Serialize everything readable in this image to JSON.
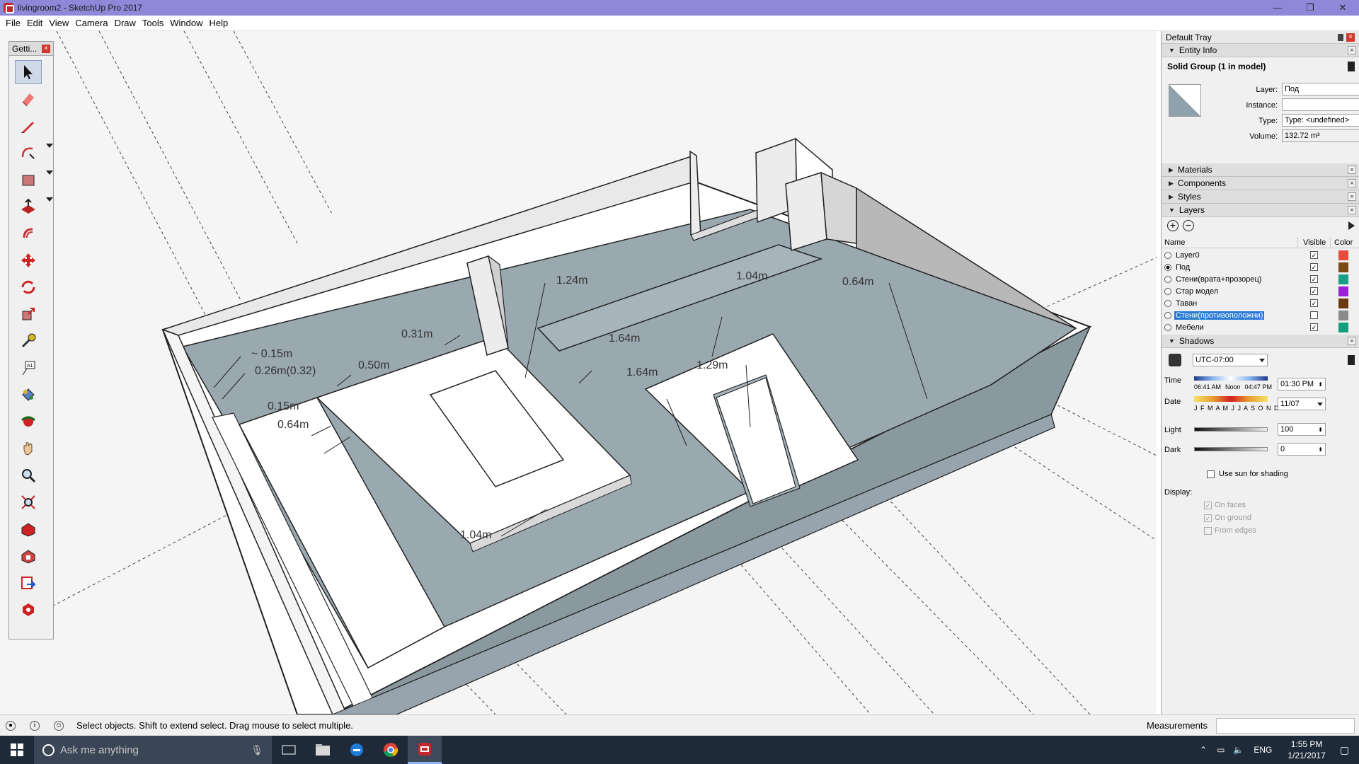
{
  "window": {
    "title": "livingroom2 - SketchUp Pro 2017",
    "controls": [
      "—",
      "❐",
      "✕"
    ]
  },
  "menu": [
    "File",
    "Edit",
    "View",
    "Camera",
    "Draw",
    "Tools",
    "Window",
    "Help"
  ],
  "toolbar": {
    "title": "Getti...",
    "tools": [
      "select-tool",
      "eraser-tool",
      "line-tool",
      "arc-tool",
      "shape-tool",
      "push-pull-tool",
      "offset-tool",
      "move-tool",
      "rotate-tool",
      "scale-tool",
      "tape-measure-tool",
      "text-tool",
      "paint-bucket-tool",
      "orbit-tool",
      "pan-tool",
      "zoom-tool",
      "zoom-extents-tool",
      "3d-warehouse-tool",
      "extension-warehouse-tool",
      "send-to-layout-tool",
      "extension-manager-tool"
    ]
  },
  "dimensions": [
    "1.24m",
    "1.04m",
    "0.64m",
    "0.31m",
    "~ 0.15m",
    "0.26m(0.32)",
    "0.50m",
    "1.64m",
    "1.64m",
    "1.29m",
    "0.15m",
    "0.64m",
    "1.04m"
  ],
  "tray": {
    "title": "Default Tray",
    "entity_info": {
      "header": "Entity Info",
      "selection": "Solid Group (1 in model)",
      "layer_label": "Layer:",
      "layer_value": "Под",
      "instance_label": "Instance:",
      "instance_value": "",
      "type_label": "Type:",
      "type_value": "Type: <undefined>",
      "volume_label": "Volume:",
      "volume_value": "132.72 m³"
    },
    "collapsed_panels": [
      "Materials",
      "Components",
      "Styles"
    ],
    "layers": {
      "header": "Layers",
      "columns": [
        "Name",
        "Visible",
        "Color"
      ],
      "rows": [
        {
          "name": "Layer0",
          "active": false,
          "visible": true,
          "color": "#e84b3c"
        },
        {
          "name": "Под",
          "active": true,
          "visible": true,
          "color": "#7a4a12"
        },
        {
          "name": "Стени(врата+прозорец)",
          "active": false,
          "visible": true,
          "color": "#16a085"
        },
        {
          "name": "Стар модел",
          "active": false,
          "visible": true,
          "color": "#9b21d6"
        },
        {
          "name": "Таван",
          "active": false,
          "visible": true,
          "color": "#6b3a10"
        },
        {
          "name": "Стени(противоположни)",
          "active": false,
          "visible": false,
          "color": "#8a8a8a",
          "selected": true
        },
        {
          "name": "Мебели",
          "active": false,
          "visible": true,
          "color": "#12a07a"
        }
      ]
    },
    "shadows": {
      "header": "Shadows",
      "timezone": "UTC-07:00",
      "time_label": "Time",
      "time_ticks": [
        "06:41 AM",
        "Noon",
        "04:47 PM"
      ],
      "time_value": "01:30 PM",
      "date_label": "Date",
      "date_ticks": "J F M A M J J A S O N D",
      "date_value": "11/07",
      "light_label": "Light",
      "light_value": "100",
      "dark_label": "Dark",
      "dark_value": "0",
      "use_sun_label": "Use sun for shading",
      "display_label": "Display:",
      "on_faces": "On faces",
      "on_ground": "On ground",
      "from_edges": "From edges"
    }
  },
  "status": {
    "hint": "Select objects. Shift to extend select. Drag mouse to select multiple.",
    "measurements_label": "Measurements"
  },
  "taskbar": {
    "search_placeholder": "Ask me anything",
    "lang": "ENG",
    "time": "1:55 PM",
    "date": "1/21/2017"
  }
}
